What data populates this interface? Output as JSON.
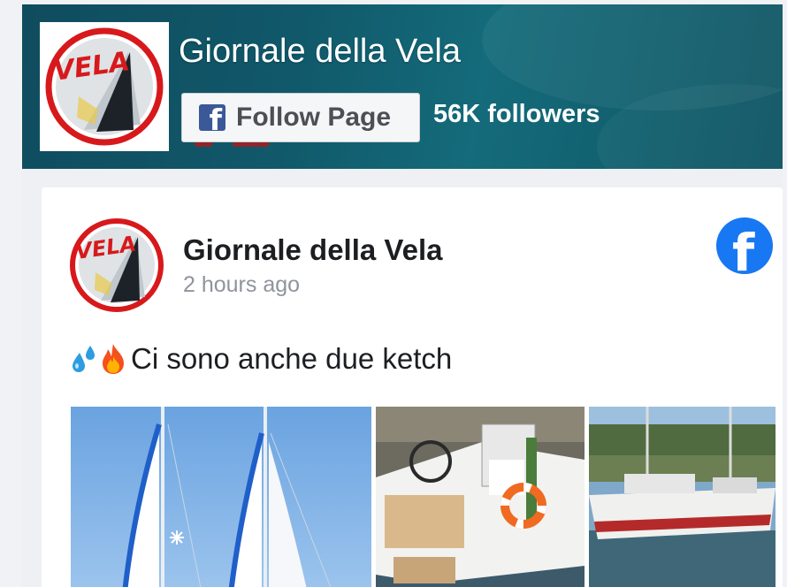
{
  "page": {
    "name": "Giornale della Vela",
    "follow_label": "Follow Page",
    "followers": "56K followers",
    "logo_text": "VELA"
  },
  "post": {
    "author": "Giornale della Vela",
    "time": "2 hours ago",
    "emojis": [
      "sweat-droplets-icon",
      "fire-icon"
    ],
    "text": "Ci sono anche due ketch"
  },
  "icons": {
    "follow": "facebook-f-icon",
    "platform": "facebook-logo-icon"
  },
  "colors": {
    "facebook_blue": "#1877f2",
    "follow_icon_blue": "#3b5998",
    "cover_teal": "#10586a",
    "logo_red": "#d7191c"
  }
}
